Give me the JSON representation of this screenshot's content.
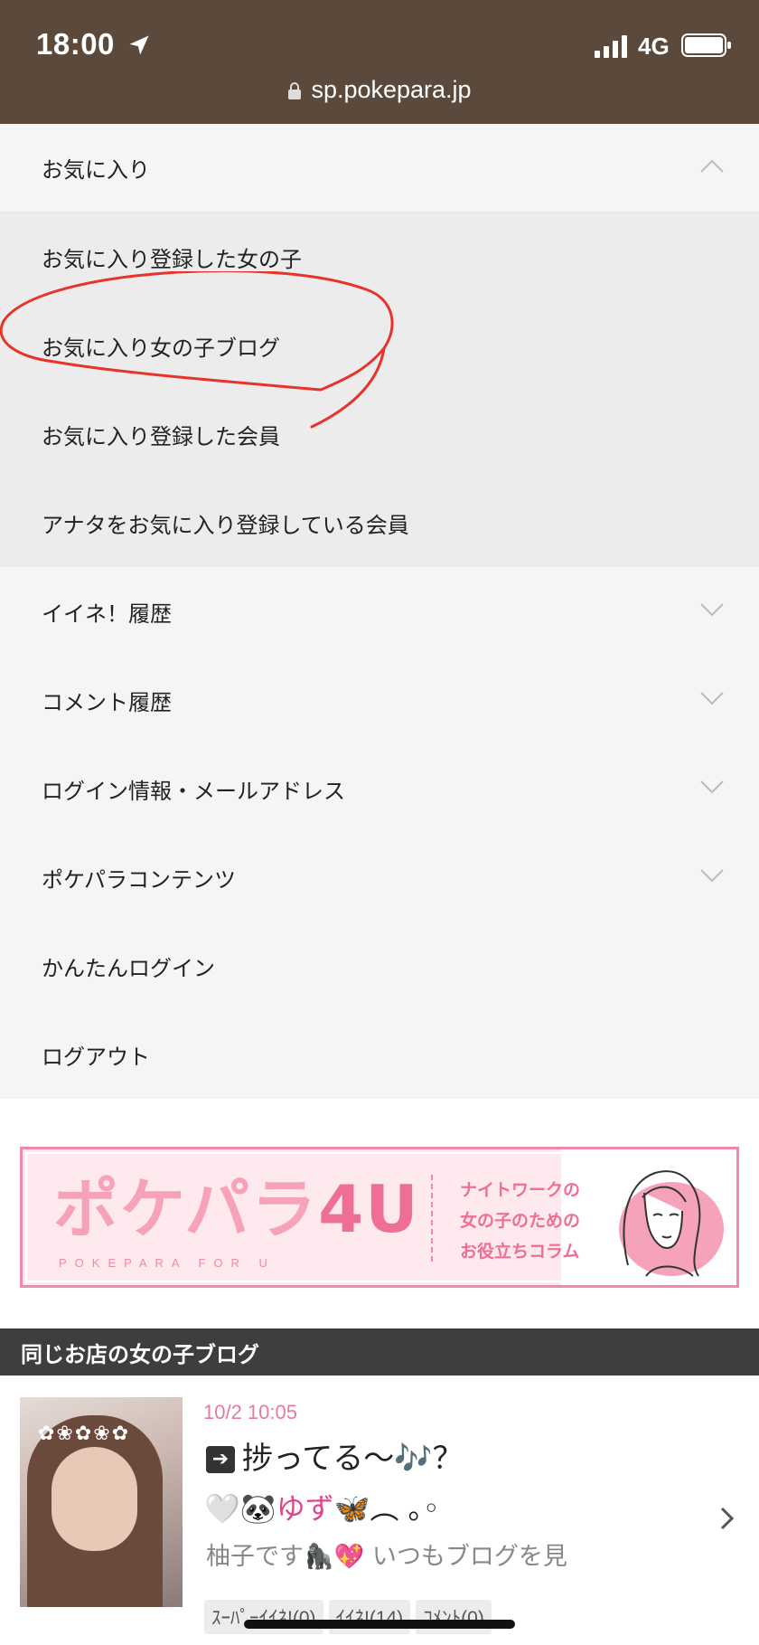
{
  "status_bar": {
    "time": "18:00",
    "network": "4G"
  },
  "url_bar": {
    "url": "sp.pokepara.jp"
  },
  "menu": {
    "favorites_header": "お気に入り",
    "favorites_items": [
      "お気に入り登録した女の子",
      "お気に入り女の子ブログ",
      "お気に入り登録した会員",
      "アナタをお気に入り登録している会員"
    ],
    "items": [
      {
        "label": "イイネ！履歴",
        "chevron": true
      },
      {
        "label": "コメント履歴",
        "chevron": true
      },
      {
        "label": "ログイン情報・メールアドレス",
        "chevron": true
      },
      {
        "label": "ポケパラコンテンツ",
        "chevron": true
      },
      {
        "label": "かんたんログイン",
        "chevron": false
      },
      {
        "label": "ログアウト",
        "chevron": false
      }
    ]
  },
  "banner": {
    "logo_main": "ポケパラ",
    "logo_suffix": "4U",
    "logo_sub": "POKEPARA FOR U",
    "tagline": [
      "ナイトワークの",
      "女の子のための",
      "お役立ちコラム"
    ]
  },
  "section": {
    "title": "同じお店の女の子ブログ"
  },
  "blog": {
    "date": "10/2 10:05",
    "title_arrow": "➔",
    "title": "捗ってる〜🎶？",
    "line2_prefix": "🤍🐼",
    "line2_name": "ゆず",
    "line2_suffix": "🦋︵ ｡◦",
    "description": "柚子です🦍💖 いつもブログを見",
    "chips": [
      "ｽｰﾊﾟｰｲｲﾈ!(0)",
      "ｲｲﾈ!(14)",
      "ｺﾒﾝﾄ(0)"
    ]
  },
  "colors": {
    "topbar": "#5b4a3b",
    "accent_pink": "#e57aa0",
    "section_bar": "#3e3e3e",
    "annotation_red": "#e8332a"
  }
}
